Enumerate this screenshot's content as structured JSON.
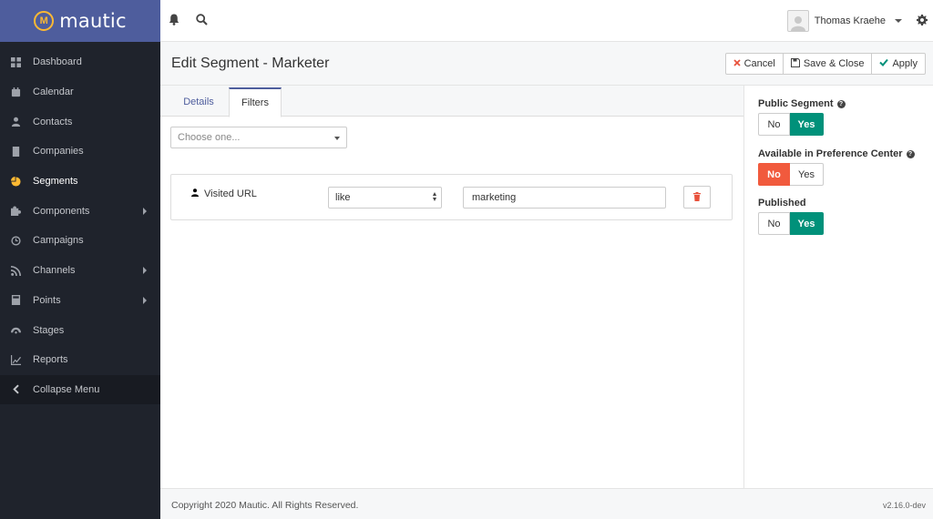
{
  "brand": {
    "name": "mautic",
    "logo_letter": "M"
  },
  "sidebar": {
    "items": [
      {
        "label": "Dashboard",
        "icon": "dashboard-icon",
        "has_sub": false,
        "active": false
      },
      {
        "label": "Calendar",
        "icon": "calendar-icon",
        "has_sub": false,
        "active": false
      },
      {
        "label": "Contacts",
        "icon": "user-icon",
        "has_sub": false,
        "active": false
      },
      {
        "label": "Companies",
        "icon": "building-icon",
        "has_sub": false,
        "active": false
      },
      {
        "label": "Segments",
        "icon": "pie-chart-icon",
        "has_sub": false,
        "active": true
      },
      {
        "label": "Components",
        "icon": "puzzle-icon",
        "has_sub": true,
        "active": false
      },
      {
        "label": "Campaigns",
        "icon": "clock-icon",
        "has_sub": false,
        "active": false
      },
      {
        "label": "Channels",
        "icon": "rss-icon",
        "has_sub": true,
        "active": false
      },
      {
        "label": "Points",
        "icon": "calculator-icon",
        "has_sub": true,
        "active": false
      },
      {
        "label": "Stages",
        "icon": "gauge-icon",
        "has_sub": false,
        "active": false
      },
      {
        "label": "Reports",
        "icon": "line-chart-icon",
        "has_sub": false,
        "active": false
      }
    ],
    "collapse_label": "Collapse Menu"
  },
  "topbar": {
    "user_name": "Thomas Kraehe"
  },
  "header": {
    "title": "Edit Segment - Marketer",
    "cancel_label": "Cancel",
    "save_close_label": "Save & Close",
    "apply_label": "Apply"
  },
  "tabs": [
    {
      "label": "Details",
      "active": false
    },
    {
      "label": "Filters",
      "active": true
    }
  ],
  "filters": {
    "choose_placeholder": "Choose one...",
    "rows": [
      {
        "field": "Visited URL",
        "operator": "like",
        "value": "marketing"
      }
    ]
  },
  "options": {
    "public_segment": {
      "label": "Public Segment",
      "no": "No",
      "yes": "Yes",
      "selected": "Yes"
    },
    "preference_center": {
      "label": "Available in Preference Center",
      "no": "No",
      "yes": "Yes",
      "selected": "No"
    },
    "published": {
      "label": "Published",
      "no": "No",
      "yes": "Yes",
      "selected": "Yes"
    }
  },
  "footer": {
    "copyright": "Copyright 2020 Mautic. All Rights Reserved.",
    "version": "v2.16.0-dev"
  },
  "colors": {
    "brand": "#4e5d9d",
    "sidebar": "#1f232c",
    "accent": "#fdb933",
    "success": "#00917a",
    "danger": "#f15a3d"
  }
}
